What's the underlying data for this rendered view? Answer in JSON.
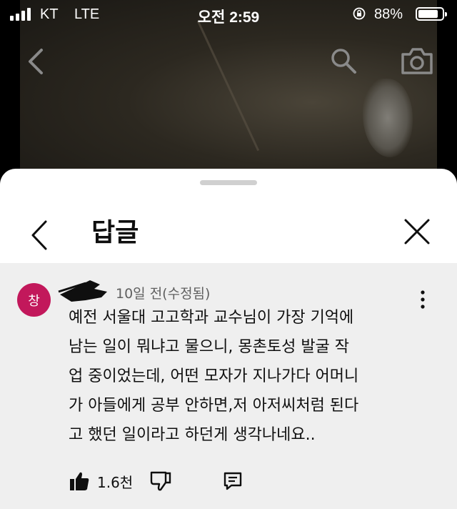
{
  "status_bar": {
    "carrier": "KT",
    "network": "LTE",
    "time": "오전 2:59",
    "battery_percent": "88%",
    "battery_level": 0.88,
    "icons": [
      "signal-icon",
      "rotation-lock-icon",
      "battery-icon"
    ]
  },
  "video": {
    "icons": [
      "back-arrow-icon",
      "search-icon",
      "camera-icon"
    ]
  },
  "sheet": {
    "title": "답글",
    "icons": [
      "chevron-left-icon",
      "close-icon"
    ]
  },
  "comment": {
    "avatar_letter": "창",
    "avatar_color": "#c2185b",
    "meta": "10일 전(수정됨)",
    "text_lines": [
      "예전 서울대 고고학과 교수님이 가장 기억에",
      "남는 일이 뭐냐고 물으니, 몽촌토성 발굴 작",
      "업 중이었는데, 어떤 모자가 지나가다 어머니",
      "가 아들에게 공부 안하면,저 아저씨처럼 된다",
      "고 했던 일이라고 하던게 생각나네요.."
    ],
    "like_count": "1.6천",
    "icons": [
      "more-vert-icon",
      "thumbs-up-icon",
      "thumbs-down-icon",
      "reply-icon"
    ]
  }
}
